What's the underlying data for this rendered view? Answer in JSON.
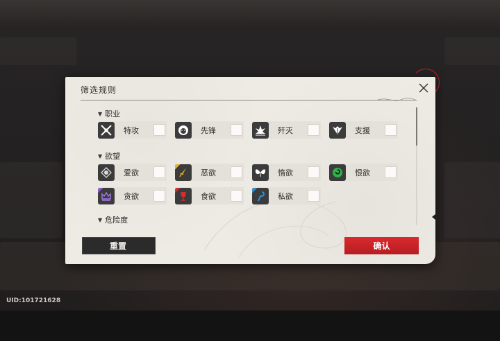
{
  "uid_label": "UID:101721628",
  "dialog": {
    "title": "筛选规则",
    "close_icon": "close-icon",
    "sections": [
      {
        "heading": "职业",
        "options": [
          {
            "label": "特攻",
            "icon": "crossed-weapons-icon",
            "icon_bg": "#3b3b3b"
          },
          {
            "label": "先锋",
            "icon": "lion-head-icon",
            "icon_bg": "#3b3b3b"
          },
          {
            "label": "歼灭",
            "icon": "explosion-icon",
            "icon_bg": "#3b3b3b"
          },
          {
            "label": "支援",
            "icon": "wings-icon",
            "icon_bg": "#3b3b3b"
          }
        ]
      },
      {
        "heading": "欲望",
        "options": [
          {
            "label": "爱欲",
            "icon": "eye-diamond-icon",
            "icon_bg": "#3b3b3b"
          },
          {
            "label": "恶欲",
            "icon": "dagger-icon",
            "icon_bg": "#3b3b3b",
            "accent": "#e2b52a"
          },
          {
            "label": "惰欲",
            "icon": "butterfly-icon",
            "icon_bg": "#3b3b3b"
          },
          {
            "label": "恨欲",
            "icon": "spiral-icon",
            "icon_bg": "#3b3b3b",
            "accent": "#2fb24a"
          },
          {
            "label": "贪欲",
            "icon": "crown-icon",
            "icon_bg": "#3b3b3b",
            "accent": "#8d5ad6"
          },
          {
            "label": "食欲",
            "icon": "goblet-icon",
            "icon_bg": "#3b3b3b",
            "accent": "#d92a2e"
          },
          {
            "label": "私欲",
            "icon": "hook-icon",
            "icon_bg": "#3b3b3b",
            "accent": "#2f8fd9"
          }
        ]
      },
      {
        "heading": "危险度",
        "options": []
      }
    ],
    "reset_label": "重置",
    "confirm_label": "确认"
  },
  "colors": {
    "accent_red": "#d92a2e",
    "dialog_bg": "#eeebe5",
    "reset_bg": "#2c2b2b"
  }
}
